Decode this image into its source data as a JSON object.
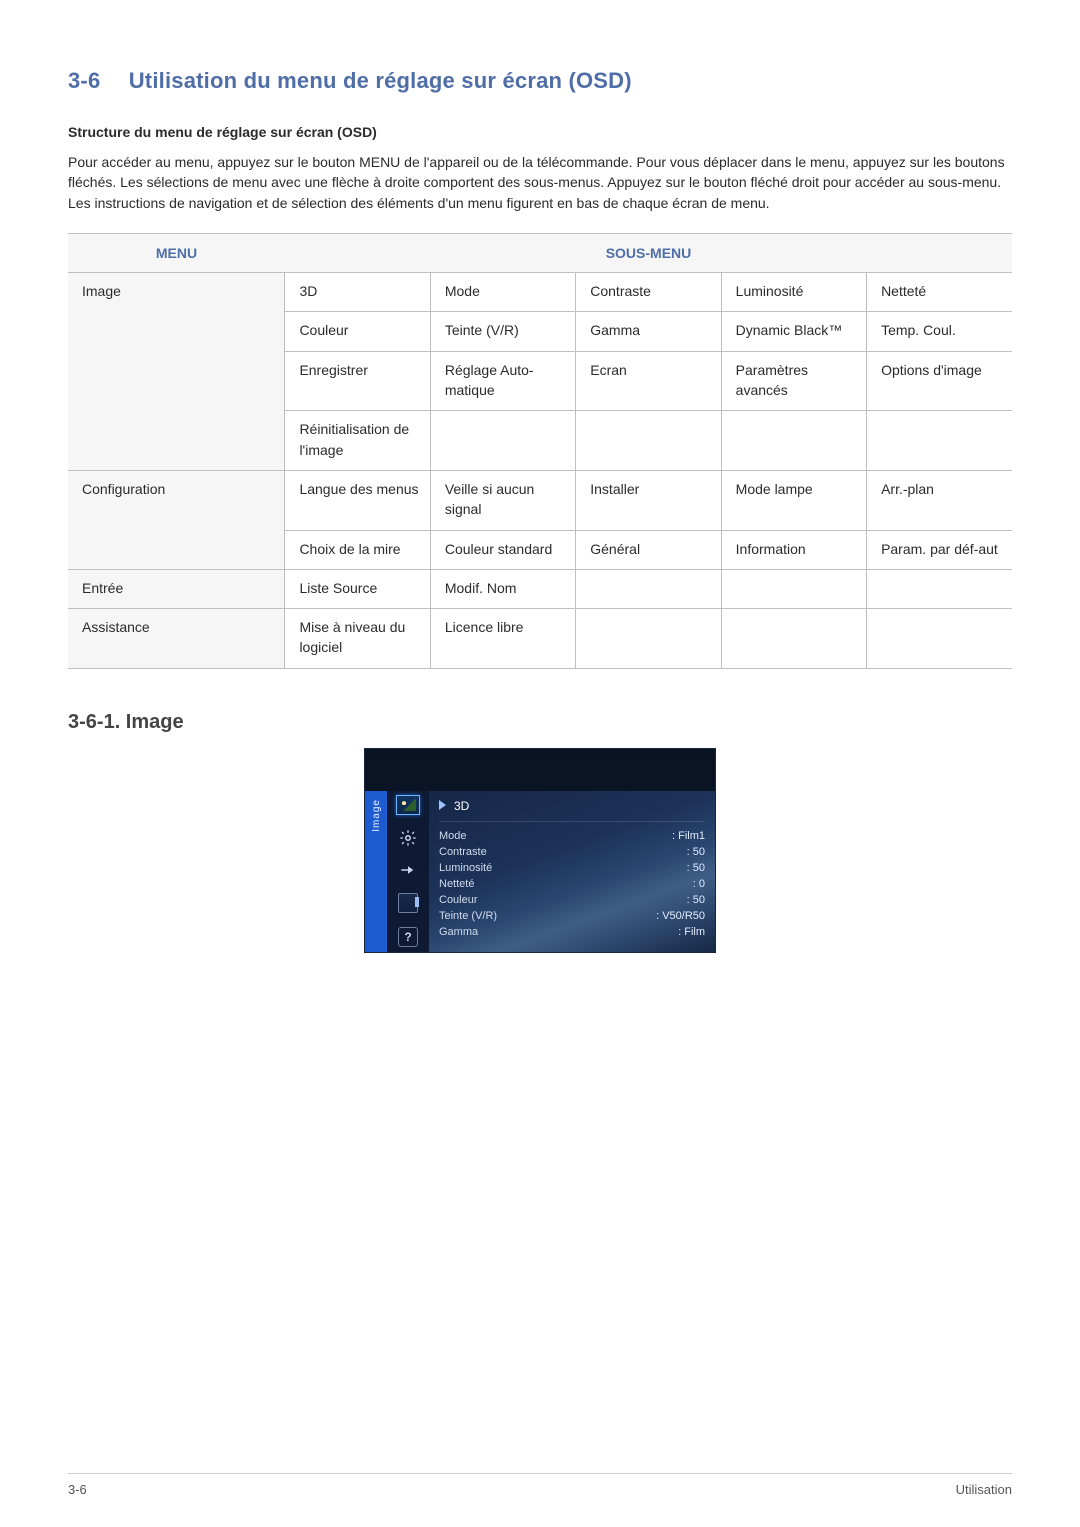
{
  "heading": {
    "number": "3-6",
    "title": "Utilisation du menu de réglage sur écran (OSD)"
  },
  "structure_title": "Structure du menu de réglage sur écran (OSD)",
  "paragraph": "Pour accéder au menu, appuyez sur le bouton MENU de l'appareil ou de la télécommande. Pour vous déplacer dans le menu, appuyez sur les boutons fléchés. Les sélections de menu avec une flèche à droite comportent des sous-menus. Appuyez sur le bouton fléché droit pour accéder au sous-menu. Les instructions de navigation et de sélection des éléments d'un menu figurent en bas de chaque écran de menu.",
  "table": {
    "headers": {
      "menu": "MENU",
      "submenu": "SOUS-MENU"
    },
    "rows": [
      {
        "category": "Image",
        "cells": [
          "3D",
          "Mode",
          "Contraste",
          "Luminosité",
          "Netteté"
        ]
      },
      {
        "category": "",
        "cells": [
          "Couleur",
          "Teinte (V/R)",
          "Gamma",
          "Dynamic Black™",
          "Temp. Coul."
        ]
      },
      {
        "category": "",
        "cells": [
          "Enregistrer",
          "Réglage Auto-matique",
          "Ecran",
          "Paramètres avancés",
          "Options d'image"
        ]
      },
      {
        "category": "",
        "cells": [
          "Réinitialisation de l'image",
          "",
          "",
          "",
          ""
        ]
      },
      {
        "category": "Configuration",
        "cells": [
          "Langue des menus",
          "Veille si aucun signal",
          "Installer",
          "Mode lampe",
          "Arr.-plan"
        ]
      },
      {
        "category": "",
        "cells": [
          "Choix de la mire",
          "Couleur standard",
          "Général",
          "Information",
          "Param. par déf-aut"
        ]
      },
      {
        "category": "Entrée",
        "cells": [
          "Liste Source",
          "Modif. Nom",
          "",
          "",
          ""
        ]
      },
      {
        "category": "Assistance",
        "cells": [
          "Mise à niveau du logiciel",
          "Licence libre",
          "",
          "",
          ""
        ]
      }
    ],
    "rowspans": {
      "0": 4,
      "4": 2,
      "6": 1,
      "7": 1
    }
  },
  "subsection": "3-6-1. Image",
  "osd": {
    "tab": "Image",
    "header": "3D",
    "items": [
      {
        "label": "Mode",
        "value": ": Film1"
      },
      {
        "label": "Contraste",
        "value": ": 50"
      },
      {
        "label": "Luminosité",
        "value": ": 50"
      },
      {
        "label": "Netteté",
        "value": ": 0"
      },
      {
        "label": "Couleur",
        "value": ": 50"
      },
      {
        "label": "Teinte (V/R)",
        "value": ": V50/R50"
      },
      {
        "label": "Gamma",
        "value": ": Film"
      }
    ],
    "help": "?"
  },
  "chart_data": {
    "type": "table",
    "title": "Structure du menu de réglage sur écran (OSD)",
    "columns": [
      "MENU",
      "SOUS-MENU"
    ],
    "rows": [
      [
        "Image",
        [
          "3D",
          "Mode",
          "Contraste",
          "Luminosité",
          "Netteté",
          "Couleur",
          "Teinte (V/R)",
          "Gamma",
          "Dynamic Black™",
          "Temp. Coul.",
          "Enregistrer",
          "Réglage Automatique",
          "Ecran",
          "Paramètres avancés",
          "Options d'image",
          "Réinitialisation de l'image"
        ]
      ],
      [
        "Configuration",
        [
          "Langue des menus",
          "Veille si aucun signal",
          "Installer",
          "Mode lampe",
          "Arr.-plan",
          "Choix de la mire",
          "Couleur standard",
          "Général",
          "Information",
          "Param. par défaut"
        ]
      ],
      [
        "Entrée",
        [
          "Liste Source",
          "Modif. Nom"
        ]
      ],
      [
        "Assistance",
        [
          "Mise à niveau du logiciel",
          "Licence libre"
        ]
      ]
    ]
  },
  "footer": {
    "left": "3-6",
    "right": "Utilisation"
  }
}
